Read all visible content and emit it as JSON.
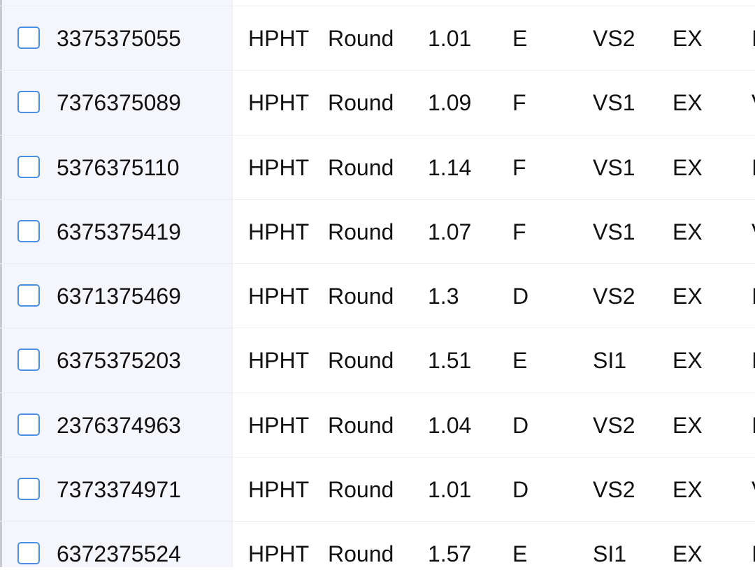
{
  "rows": [
    {
      "id": "3375375055",
      "method": "HPHT",
      "shape": "Round",
      "carat": "1.01",
      "color": "E",
      "clarity": "VS2",
      "cut": "EX",
      "next": "I"
    },
    {
      "id": "7376375089",
      "method": "HPHT",
      "shape": "Round",
      "carat": "1.09",
      "color": "F",
      "clarity": "VS1",
      "cut": "EX",
      "next": "V"
    },
    {
      "id": "5376375110",
      "method": "HPHT",
      "shape": "Round",
      "carat": "1.14",
      "color": "F",
      "clarity": "VS1",
      "cut": "EX",
      "next": "I"
    },
    {
      "id": "6375375419",
      "method": "HPHT",
      "shape": "Round",
      "carat": "1.07",
      "color": "F",
      "clarity": "VS1",
      "cut": "EX",
      "next": "V"
    },
    {
      "id": "6371375469",
      "method": "HPHT",
      "shape": "Round",
      "carat": "1.3",
      "color": "D",
      "clarity": "VS2",
      "cut": "EX",
      "next": "I"
    },
    {
      "id": "6375375203",
      "method": "HPHT",
      "shape": "Round",
      "carat": "1.51",
      "color": "E",
      "clarity": "SI1",
      "cut": "EX",
      "next": "I"
    },
    {
      "id": "2376374963",
      "method": "HPHT",
      "shape": "Round",
      "carat": "1.04",
      "color": "D",
      "clarity": "VS2",
      "cut": "EX",
      "next": "I"
    },
    {
      "id": "7373374971",
      "method": "HPHT",
      "shape": "Round",
      "carat": "1.01",
      "color": "D",
      "clarity": "VS2",
      "cut": "EX",
      "next": "V"
    },
    {
      "id": "6372375524",
      "method": "HPHT",
      "shape": "Round",
      "carat": "1.57",
      "color": "E",
      "clarity": "SI1",
      "cut": "EX",
      "next": "I"
    }
  ],
  "colors": {
    "checkbox_border": "#4a90e2",
    "frozen_column_bg": "#f5f6fb"
  }
}
